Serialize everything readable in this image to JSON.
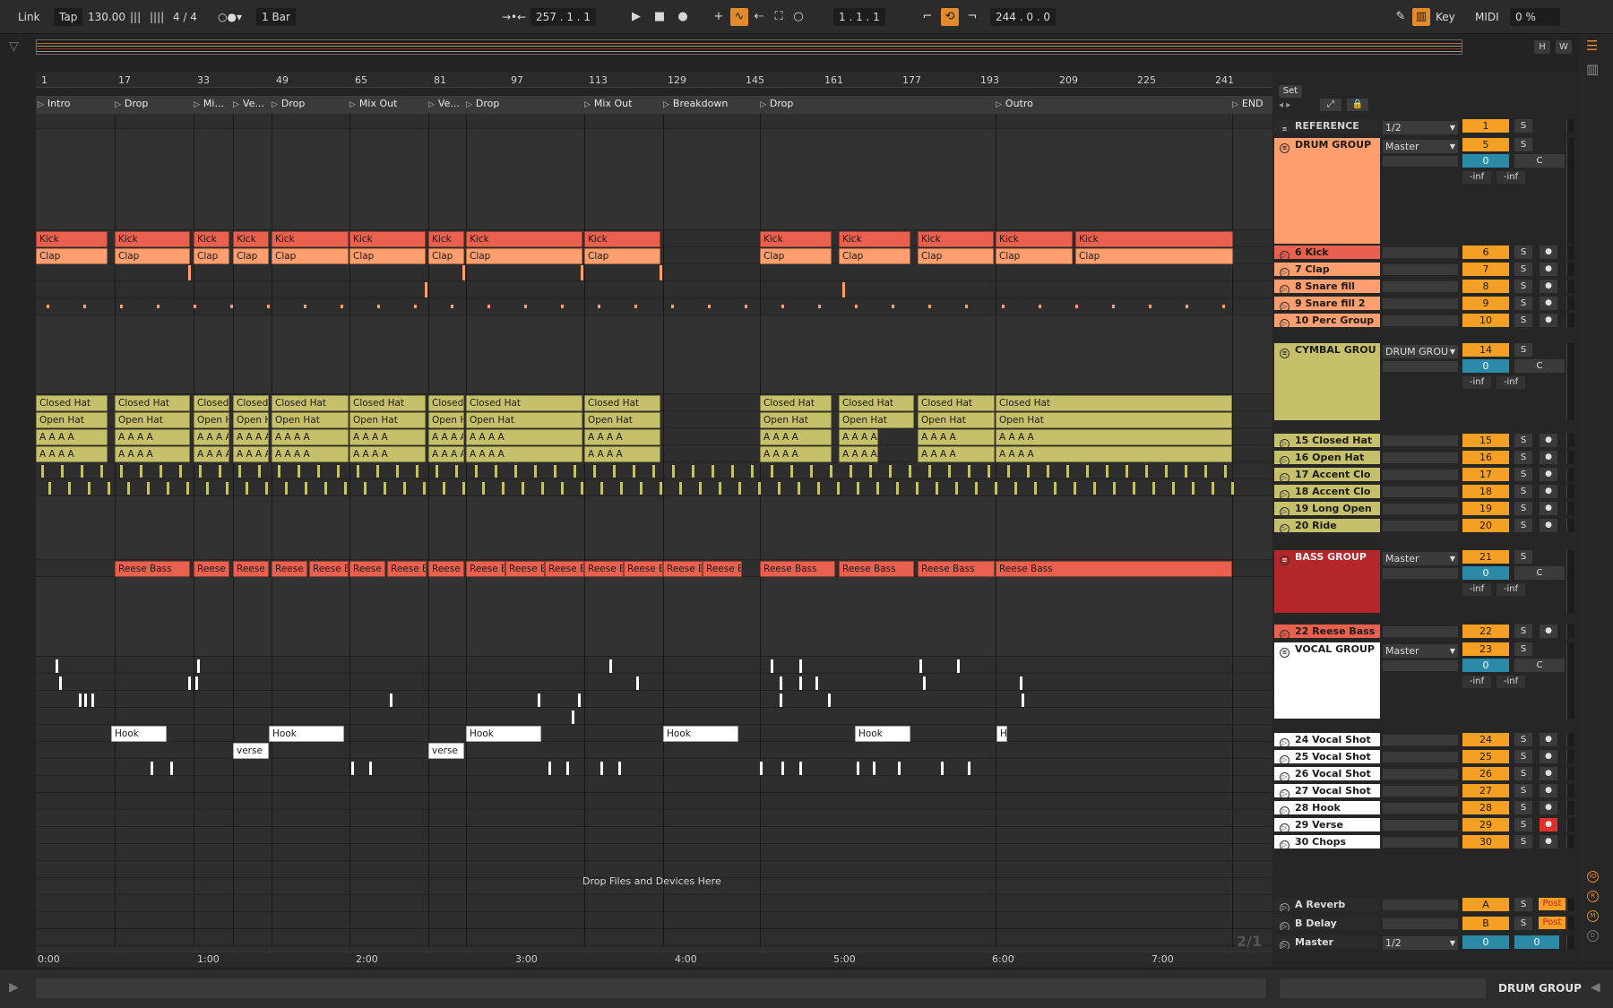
{
  "transport": {
    "link": "Link",
    "tap": "Tap",
    "tempo": "130.00",
    "signature": "4 / 4",
    "quantize": "1 Bar",
    "position": "257 .   1 .   1",
    "loop_start": "1 .   1 .   1",
    "loop_length": "244 .   0 .   0",
    "key": "Key",
    "midi": "MIDI",
    "cpu": "0 %"
  },
  "overview": {
    "h": "H",
    "w": "W"
  },
  "ruler": {
    "bars": [
      "1",
      "17",
      "33",
      "49",
      "65",
      "81",
      "97",
      "113",
      "129",
      "145",
      "161",
      "177",
      "193",
      "209",
      "225",
      "241"
    ]
  },
  "locators": [
    "Intro",
    "Drop",
    "Mi...",
    "Ve...",
    "Drop",
    "Mix Out",
    "Ve...",
    "Drop",
    "Mix Out",
    "Breakdown",
    "Drop",
    "Outro",
    "END"
  ],
  "timeline": [
    "0:00",
    "1:00",
    "2:00",
    "3:00",
    "4:00",
    "5:00",
    "6:00",
    "7:00"
  ],
  "zoom_label": "2/1",
  "drop_hint": "Drop Files and Devices Here",
  "set_button": "Set",
  "clips": {
    "kick": "Kick",
    "clap": "Clap",
    "closed_hat": "Closed Hat",
    "open_hat": "Open Hat",
    "reese": "Reese Bass",
    "hook": "Hook",
    "verse": "verse",
    "accent": "A"
  },
  "tracks": [
    {
      "name": "REFERENCE",
      "num": "1",
      "routing": "1/2",
      "color": "#2a2a2a",
      "text": "#d0d0d0"
    },
    {
      "name": "DRUM GROUP",
      "num": "5",
      "routing": "Master",
      "color": "#ff9e6e",
      "text": "#1b1b1b"
    },
    {
      "name": "6 Kick",
      "num": "6",
      "color": "#e9604e"
    },
    {
      "name": "7 Clap",
      "num": "7",
      "color": "#ff9e6e"
    },
    {
      "name": "8 Snare fill",
      "num": "8",
      "color": "#ff9e6e"
    },
    {
      "name": "9 Snare fill 2",
      "num": "9",
      "color": "#ff9e6e"
    },
    {
      "name": "10 Perc Group",
      "num": "10",
      "color": "#ff9e6e"
    },
    {
      "name": "CYMBAL GROU",
      "num": "14",
      "routing": "DRUM GROU",
      "color": "#c6c06a"
    },
    {
      "name": "15 Closed Hat",
      "num": "15",
      "color": "#c6c06a"
    },
    {
      "name": "16 Open Hat",
      "num": "16",
      "color": "#c6c06a"
    },
    {
      "name": "17 Accent Clo",
      "num": "17",
      "color": "#c6c06a"
    },
    {
      "name": "18 Accent Clo",
      "num": "18",
      "color": "#c6c06a"
    },
    {
      "name": "19 Long Open",
      "num": "19",
      "color": "#c6c06a"
    },
    {
      "name": "20 Ride",
      "num": "20",
      "color": "#c6c06a"
    },
    {
      "name": "BASS GROUP",
      "num": "21",
      "routing": "Master",
      "color": "#b3262a",
      "text": "#f0f0f0"
    },
    {
      "name": "22 Reese Bass",
      "num": "22",
      "color": "#e9604e"
    },
    {
      "name": "VOCAL GROUP",
      "num": "23",
      "routing": "Master",
      "color": "#ffffff"
    },
    {
      "name": "24 Vocal Shot",
      "num": "24",
      "color": "#ffffff"
    },
    {
      "name": "25 Vocal Shot",
      "num": "25",
      "color": "#ffffff"
    },
    {
      "name": "26 Vocal Shot",
      "num": "26",
      "color": "#ffffff"
    },
    {
      "name": "27 Vocal Shot",
      "num": "27",
      "color": "#ffffff"
    },
    {
      "name": "28 Hook",
      "num": "28",
      "color": "#ffffff"
    },
    {
      "name": "29 Verse",
      "num": "29",
      "color": "#ffffff"
    },
    {
      "name": "30 Chops",
      "num": "30",
      "color": "#ffffff"
    }
  ],
  "returns": [
    {
      "name": "A Reverb",
      "num": "A",
      "post": "Post"
    },
    {
      "name": "B Delay",
      "num": "B",
      "post": "Post"
    },
    {
      "name": "Master",
      "num": "0",
      "routing": "1/2"
    }
  ],
  "group_values": {
    "vol": "0",
    "pan": "C",
    "inf_l": "-inf",
    "inf_r": "-inf",
    "solo": "S"
  },
  "status_track": "DRUM GROUP",
  "colors": {
    "accent": "#f4a024",
    "kick": "#e9604e",
    "drum": "#ff9e6e",
    "cymbal": "#c6c06a",
    "bass": "#b3262a",
    "vocal": "#ffffff"
  }
}
